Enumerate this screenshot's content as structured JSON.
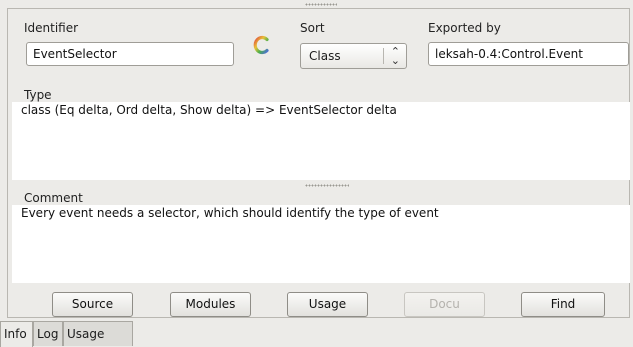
{
  "form": {
    "identifier_label": "Identifier",
    "identifier_value": "EventSelector",
    "sort_label": "Sort",
    "sort_value": "Class",
    "exported_label": "Exported by",
    "exported_value": "leksah-0.4:Control.Event"
  },
  "type": {
    "label": "Type",
    "text": "class (Eq delta, Ord delta, Show delta) => EventSelector delta"
  },
  "comment": {
    "label": "Comment",
    "text": "Every event needs a selector, which should identify the type of event"
  },
  "buttons": {
    "source": "Source",
    "modules": "Modules",
    "usage": "Usage",
    "docu": "Docu",
    "find": "Find"
  },
  "tabs": [
    "Info",
    "Log",
    "Usage"
  ],
  "colors": {
    "background": "#ecebe8",
    "pane": "#ffffff",
    "disabled_text": "#b4b2ad"
  }
}
